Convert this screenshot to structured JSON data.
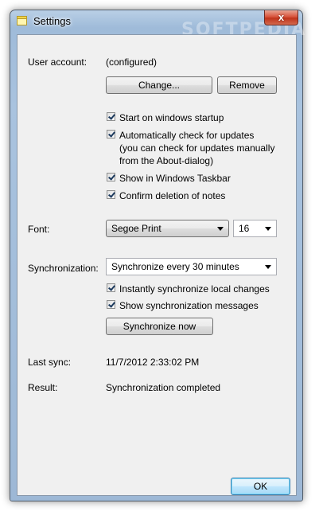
{
  "window": {
    "title": "Settings",
    "close_glyph": "x",
    "watermark": "SOFTPEDIA"
  },
  "account": {
    "label": "User account:",
    "value": "(configured)",
    "change_label": "Change...",
    "remove_label": "Remove"
  },
  "options": [
    {
      "label": "Start on windows startup",
      "checked": true
    },
    {
      "label": "Automatically check for updates",
      "checked": true
    },
    {
      "label": "Show in Windows Taskbar",
      "checked": true
    },
    {
      "label": "Confirm deletion of notes",
      "checked": true
    }
  ],
  "updates_note": [
    "(you can check for updates manually",
    "from the About-dialog)"
  ],
  "font": {
    "label": "Font:",
    "family": "Segoe Print",
    "size": "16"
  },
  "sync": {
    "label": "Synchronization:",
    "interval": "Synchronize every 30 minutes",
    "instant_label": "Instantly synchronize local changes",
    "instant_checked": true,
    "messages_label": "Show synchronization messages",
    "messages_checked": true,
    "now_label": "Synchronize now"
  },
  "status": {
    "last_sync_label": "Last sync:",
    "last_sync_value": "11/7/2012 2:33:02 PM",
    "result_label": "Result:",
    "result_value": "Synchronization completed"
  },
  "footer": {
    "ok_label": "OK"
  }
}
